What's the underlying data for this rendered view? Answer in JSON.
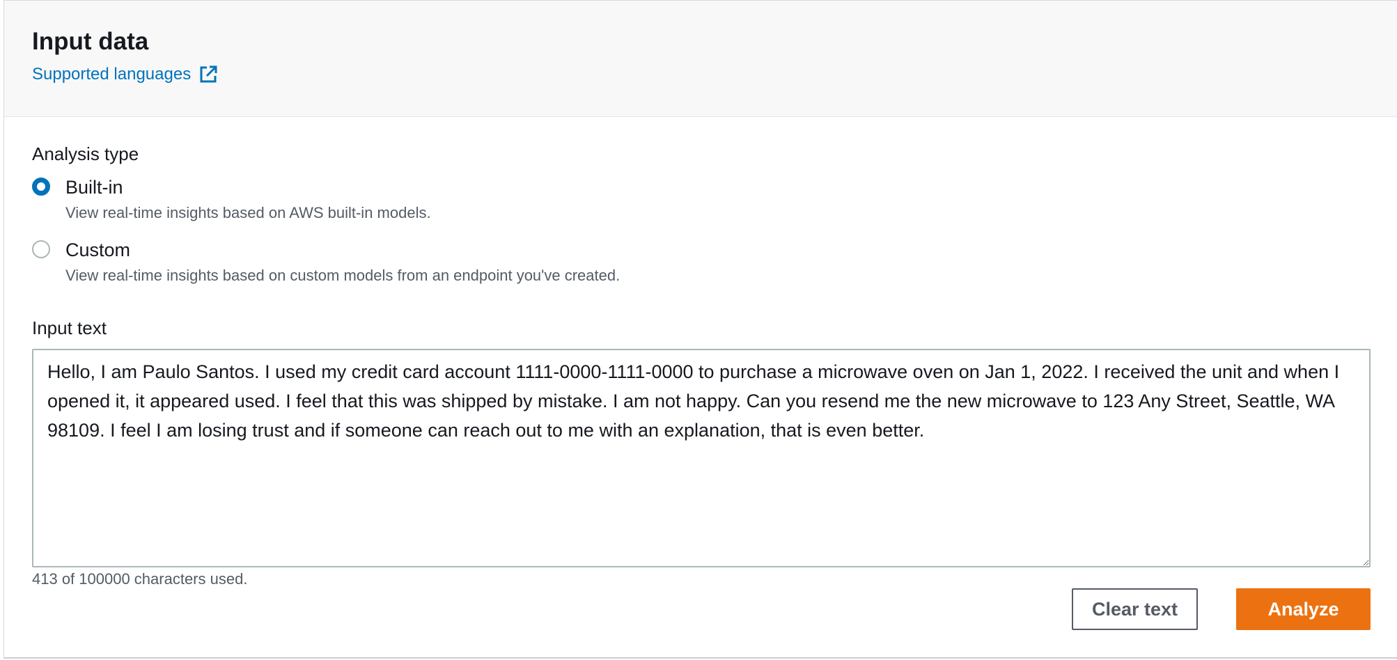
{
  "header": {
    "title": "Input data",
    "link_label": "Supported languages",
    "link_icon": "external-link-icon",
    "accent_color": "#0073bb"
  },
  "analysis": {
    "label": "Analysis type",
    "options": [
      {
        "label": "Built-in",
        "description": "View real-time insights based on AWS built-in models.",
        "selected": true
      },
      {
        "label": "Custom",
        "description": "View real-time insights based on custom models from an endpoint you've created.",
        "selected": false
      }
    ]
  },
  "input": {
    "label": "Input text",
    "value": "Hello, I am Paulo Santos. I used my credit card account 1111-0000-1111-0000 to purchase a microwave oven on Jan 1, 2022. I received the unit and when I opened it, it appeared used. I feel that this was shipped by mistake. I am not happy. Can you resend me the new microwave to 123 Any Street, Seattle, WA 98109. I feel I am losing trust and if someone can reach out to me with an explanation, that is even better.",
    "counter": "413 of 100000 characters used."
  },
  "actions": {
    "clear_label": "Clear text",
    "analyze_label": "Analyze",
    "primary_color": "#ec7211"
  }
}
